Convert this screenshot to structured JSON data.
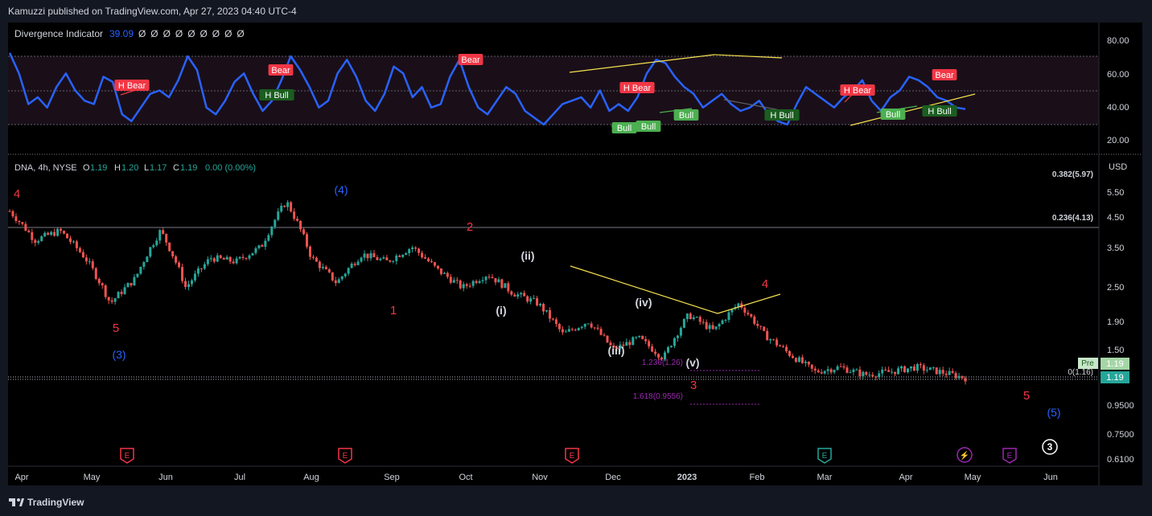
{
  "header": {
    "published": "Kamuzzi published on TradingView.com, Apr 27, 2023 04:40 UTC-4"
  },
  "footer": {
    "brand": "TradingView"
  },
  "indicator": {
    "name": "Divergence Indicator",
    "value": "39.09",
    "placeholders": [
      "Ø",
      "Ø",
      "Ø",
      "Ø",
      "Ø",
      "Ø",
      "Ø",
      "Ø",
      "Ø"
    ],
    "ticks": [
      "80.00",
      "60.00",
      "40.00",
      "20.00"
    ],
    "labels": [
      {
        "text": "H Bear",
        "kind": "bear"
      },
      {
        "text": "Bear",
        "kind": "bear"
      },
      {
        "text": "H Bull",
        "kind": "hbull"
      },
      {
        "text": "Bear",
        "kind": "bear"
      },
      {
        "text": "H Bear",
        "kind": "bear"
      },
      {
        "text": "Bull",
        "kind": "bull"
      },
      {
        "text": "Bull",
        "kind": "bull"
      },
      {
        "text": "Bull",
        "kind": "bull"
      },
      {
        "text": "H Bull",
        "kind": "hbull"
      },
      {
        "text": "H Bear",
        "kind": "bear"
      },
      {
        "text": "Bull",
        "kind": "bull"
      },
      {
        "text": "H Bull",
        "kind": "hbull"
      },
      {
        "text": "Bear",
        "kind": "bear"
      }
    ]
  },
  "price": {
    "symbol": "DNA, 4h, NYSE",
    "ohlc": {
      "o_label": "O",
      "o": "1.19",
      "h_label": "H",
      "h": "1.20",
      "l_label": "L",
      "l": "1.17",
      "c_label": "C",
      "c": "1.19",
      "change": "0.00 (0.00%)"
    },
    "currency": "USD",
    "ticks": [
      "5.50",
      "4.50",
      "3.50",
      "2.50",
      "1.90",
      "1.50",
      "0.9500",
      "0.7500",
      "0.6100"
    ],
    "fib_levels": [
      {
        "label": "0.382(5.97)"
      },
      {
        "label": "0.236(4.13)"
      },
      {
        "label": "0(1.16)"
      }
    ],
    "extensions": [
      {
        "label": "1.236(1.26)"
      },
      {
        "label": "1.618(0.9556)"
      }
    ],
    "last_price": "1.19",
    "pre_label": "Pre",
    "pre_price": "1.19",
    "wave_labels": [
      {
        "text": "4",
        "color": "#f23645"
      },
      {
        "text": "5",
        "color": "#f23645"
      },
      {
        "text": "(3)",
        "color": "#2962ff"
      },
      {
        "text": "(4)",
        "color": "#2962ff"
      },
      {
        "text": "1",
        "color": "#f23645"
      },
      {
        "text": "2",
        "color": "#f23645"
      },
      {
        "text": "(i)",
        "color": "#d1d4dc"
      },
      {
        "text": "(ii)",
        "color": "#d1d4dc"
      },
      {
        "text": "(iii)",
        "color": "#d1d4dc"
      },
      {
        "text": "(iv)",
        "color": "#d1d4dc"
      },
      {
        "text": "(v)",
        "color": "#d1d4dc"
      },
      {
        "text": "3",
        "color": "#f23645"
      },
      {
        "text": "4",
        "color": "#f23645"
      },
      {
        "text": "5",
        "color": "#f23645"
      },
      {
        "text": "(5)",
        "color": "#2962ff"
      },
      {
        "text": "3",
        "color": "#ffffff"
      }
    ],
    "events": [
      {
        "text": "E",
        "icon": "earnings-icon",
        "color": "#f23645"
      },
      {
        "text": "E",
        "icon": "earnings-icon",
        "color": "#f23645"
      },
      {
        "text": "E",
        "icon": "earnings-icon",
        "color": "#f23645"
      },
      {
        "text": "E",
        "icon": "earnings-icon",
        "color": "#26a69a"
      },
      {
        "text": "⚡",
        "icon": "lightning-icon",
        "color": "#9c27b0"
      },
      {
        "text": "E",
        "icon": "earnings-icon",
        "color": "#9c27b0"
      }
    ]
  },
  "time_axis": [
    "Apr",
    "May",
    "Jun",
    "Jul",
    "Aug",
    "Sep",
    "Oct",
    "Nov",
    "Dec",
    "2023",
    "Feb",
    "Mar",
    "Apr",
    "May",
    "Jun"
  ],
  "colors": {
    "background": "#131722",
    "rsi": "#2962ff",
    "bear": "#f23645",
    "bull": "#4caf50",
    "trend": "#f5e050",
    "candle_up": "#26a69a",
    "candle_down": "#ef5350",
    "fib": "#9c27b0"
  },
  "chart_data": [
    {
      "type": "line",
      "title": "Divergence Indicator",
      "ylim": [
        12,
        88
      ],
      "levels": [
        70,
        50,
        30
      ],
      "series": [
        {
          "name": "Divergence Indicator",
          "values": [
            72,
            60,
            42,
            46,
            40,
            52,
            60,
            50,
            44,
            42,
            58,
            55,
            36,
            32,
            40,
            48,
            50,
            46,
            56,
            70,
            62,
            40,
            36,
            44,
            55,
            60,
            48,
            38,
            44,
            56,
            70,
            62,
            52,
            40,
            44,
            60,
            68,
            58,
            44,
            38,
            48,
            64,
            60,
            46,
            52,
            40,
            42,
            58,
            68,
            52,
            40,
            36,
            44,
            52,
            48,
            38,
            34,
            30,
            36,
            42,
            44,
            46,
            40,
            50,
            38,
            42,
            38,
            46,
            60,
            68,
            66,
            58,
            52,
            48,
            40,
            44,
            48,
            42,
            38,
            40,
            44,
            36,
            32,
            30,
            42,
            52,
            48,
            44,
            40,
            46,
            50,
            56,
            44,
            38,
            46,
            50,
            58,
            56,
            52,
            46,
            44,
            40,
            39.09
          ]
        }
      ],
      "value": 39.09
    },
    {
      "type": "line",
      "title": "DNA, 4h, NYSE",
      "ylabel": "USD",
      "ylim": [
        0.6,
        6.5
      ],
      "log_scale": true,
      "categories": [
        "Apr",
        "May",
        "Jun",
        "Jul",
        "Aug",
        "Sep",
        "Oct",
        "Nov",
        "Dec",
        "2023",
        "Feb",
        "Mar",
        "Apr",
        "May",
        "Jun"
      ],
      "series": [
        {
          "name": "DNA",
          "values": [
            4.7,
            3.7,
            4.0,
            3.2,
            2.2,
            2.7,
            4.0,
            2.5,
            3.2,
            3.1,
            3.5,
            5.1,
            3.2,
            2.6,
            3.3,
            3.1,
            3.5,
            2.9,
            2.5,
            2.8,
            2.4,
            2.2,
            1.7,
            1.9,
            1.5,
            1.65,
            1.4,
            2.0,
            1.75,
            2.2,
            1.7,
            1.45,
            1.25,
            1.3,
            1.22,
            1.25,
            1.3,
            1.25,
            1.19
          ]
        }
      ],
      "last": 1.19
    }
  ]
}
